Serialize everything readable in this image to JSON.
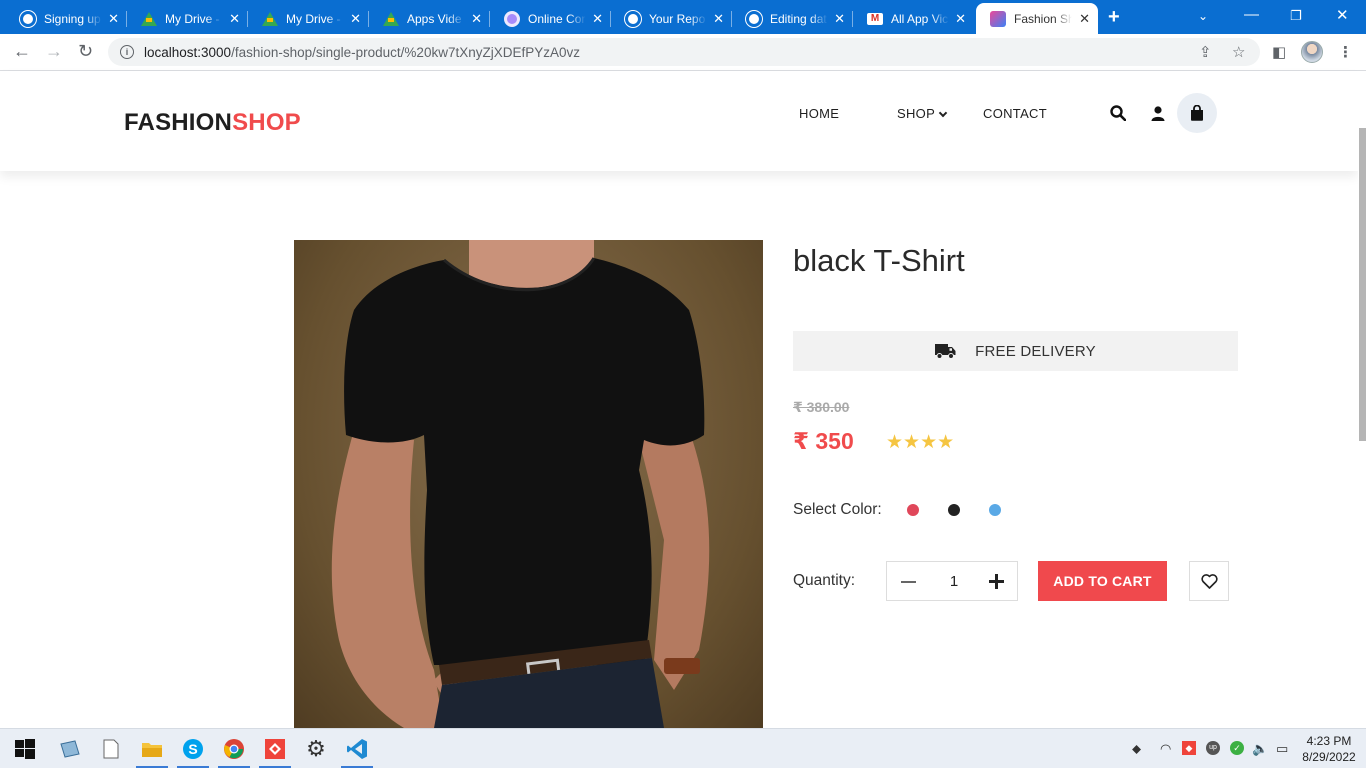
{
  "browser": {
    "tabs": [
      {
        "title": "Signing up",
        "icon": "github-icon"
      },
      {
        "title": "My Drive -",
        "icon": "google-drive-icon"
      },
      {
        "title": "My Drive -",
        "icon": "google-drive-icon"
      },
      {
        "title": "Apps Vide",
        "icon": "google-drive-icon"
      },
      {
        "title": "Online Cor",
        "icon": "circle-app-icon"
      },
      {
        "title": "Your Repo",
        "icon": "github-icon"
      },
      {
        "title": "Editing dat",
        "icon": "github-icon"
      },
      {
        "title": "All App Vic",
        "icon": "gmail-icon"
      },
      {
        "title": "Fashion Sh",
        "icon": "shop-bag-icon",
        "active": true
      }
    ],
    "url_host": "localhost:3000",
    "url_path": "/fashion-shop/single-product/%20kw7tXnyZjXDEfPYzA0vz"
  },
  "site": {
    "logo_part1": "FASHION",
    "logo_part2": "SHOP",
    "nav": {
      "home": "HOME",
      "shop": "SHOP",
      "contact": "CONTACT"
    },
    "brand_color": "#f04b4c"
  },
  "product": {
    "title": "black T-Shirt",
    "delivery_text": "FREE DELIVERY",
    "old_price": "₹ 380.00",
    "price": "₹ 350",
    "rating": 4,
    "rating_max": 4,
    "select_color_label": "Select Color:",
    "colors": [
      "#e0475a",
      "#222222",
      "#5aa9e6"
    ],
    "quantity_label": "Quantity:",
    "quantity": "1",
    "add_to_cart_label": "ADD TO CART"
  },
  "taskbar": {
    "time": "4:23 PM",
    "date": "8/29/2022"
  }
}
